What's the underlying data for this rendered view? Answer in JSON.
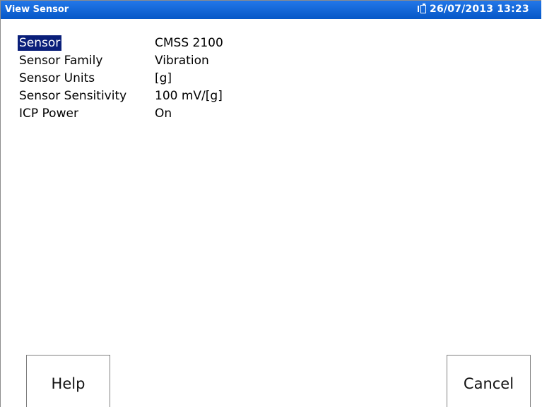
{
  "window": {
    "title": "View Sensor",
    "datetime": "26/07/2013 13:23",
    "status_icon": "battery-charging-icon"
  },
  "properties": [
    {
      "label": "Sensor",
      "value": "CMSS 2100",
      "selected": true
    },
    {
      "label": "Sensor Family",
      "value": "Vibration",
      "selected": false
    },
    {
      "label": "Sensor Units",
      "value": "[g]",
      "selected": false
    },
    {
      "label": "Sensor Sensitivity",
      "value": "100 mV/[g]",
      "selected": false
    },
    {
      "label": "ICP Power",
      "value": "On",
      "selected": false
    }
  ],
  "buttons": {
    "help_label": "Help",
    "cancel_label": "Cancel"
  },
  "colors": {
    "titlebar": "#0557c7",
    "selection": "#0a1f7a"
  }
}
